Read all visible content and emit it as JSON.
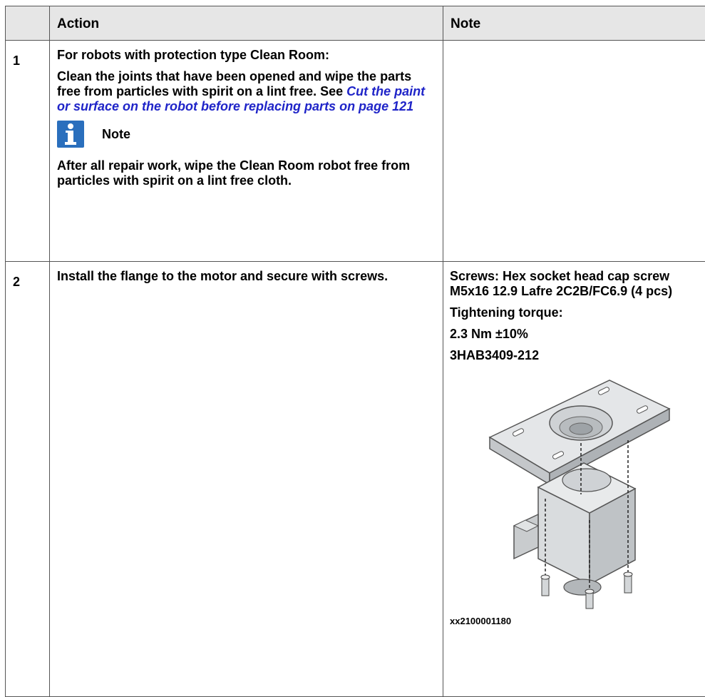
{
  "table": {
    "headers": {
      "number": "",
      "action": "Action",
      "note": "Note"
    },
    "rows": [
      {
        "number": "1",
        "action": {
          "line1": "For robots with protection type Clean Room:",
          "line2": "Clean the joints that have been opened and wipe the parts free from particles with spirit on a lint free. See",
          "link": "Cut the paint or surface on the robot before replacing parts on page 121",
          "note_label": "Note",
          "note_text": "After all repair work, wipe the Clean Room robot free from particles with spirit on a lint free cloth."
        },
        "note": {}
      },
      {
        "number": "2",
        "action": {
          "text": "Install the flange to the motor and secure with screws."
        },
        "note": {
          "screws": "Screws: Hex socket head cap screw M5x16 12.9 Lafre 2C2B/FC6.9 (4 pcs)",
          "torque_label": "Tightening torque:",
          "torque_value": "2.3 Nm ±10%",
          "part_number": "3HAB3409-212",
          "figure_caption": "xx2100001180"
        }
      }
    ]
  },
  "icons": {
    "note": "info-icon"
  },
  "colors": {
    "header_bg": "#e6e6e6",
    "link": "#1f24c8",
    "info_icon_bg": "#2a6fbd",
    "border": "#555555"
  }
}
